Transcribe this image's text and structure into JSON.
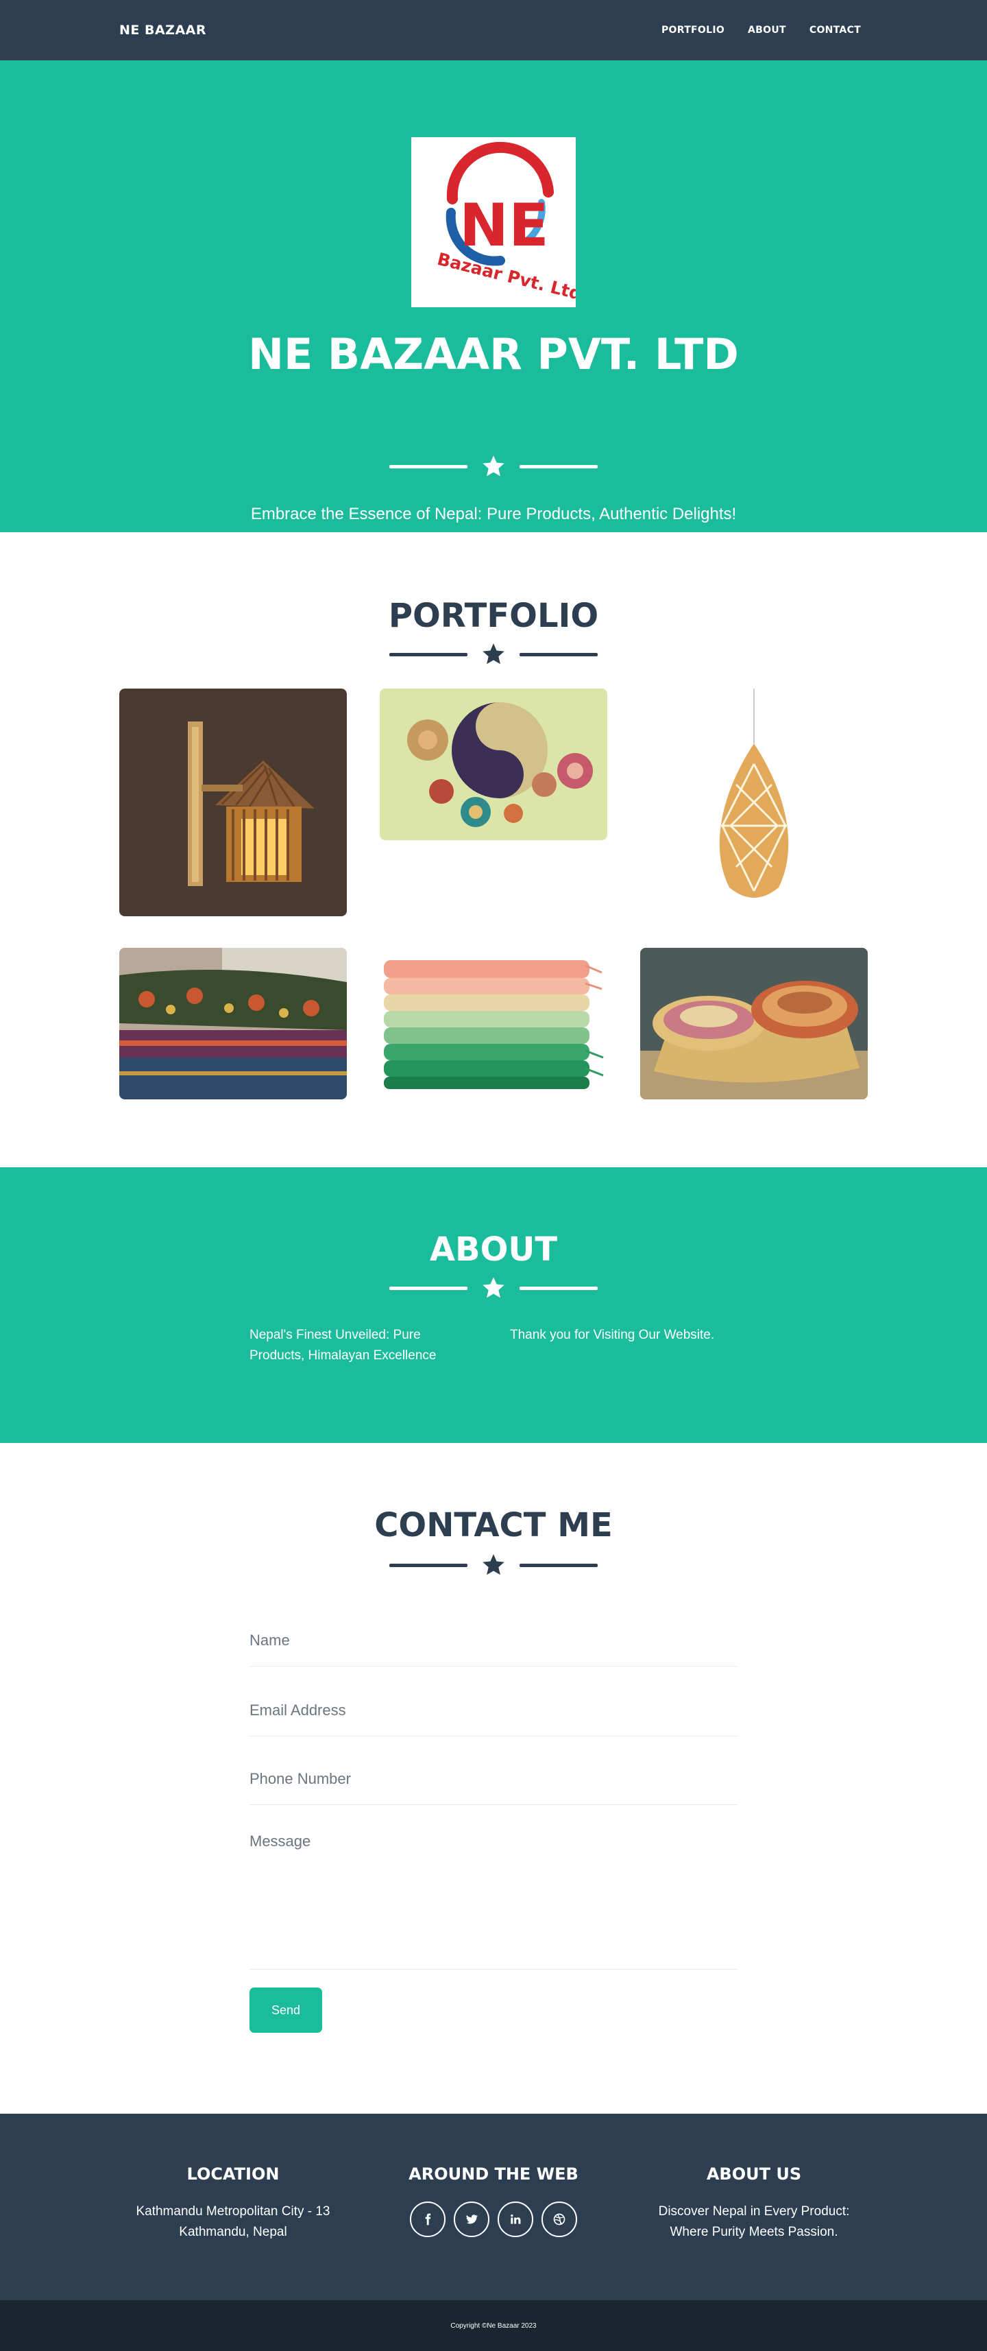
{
  "navbar": {
    "brand": "NE BAZAAR",
    "links": [
      "PORTFOLIO",
      "ABOUT",
      "CONTACT"
    ]
  },
  "hero": {
    "logo_text_top": "NE",
    "logo_text_bottom": "Bazaar Pvt. Ltd.",
    "title": "NE BAZAAR PVT. LTD",
    "tagline": "Embrace the Essence of Nepal: Pure Products, Authentic Delights!"
  },
  "portfolio": {
    "title": "PORTFOLIO",
    "items": [
      "bamboo-wall-lamp",
      "woven-wall-plates",
      "bamboo-pendant-lamp",
      "folded-woven-textiles",
      "stacked-pashmina-shawls",
      "woven-baskets"
    ]
  },
  "about": {
    "title": "ABOUT",
    "left_text": "Nepal's Finest Unveiled: Pure Products, Himalayan Excellence",
    "right_text": "Thank you for Visiting Our Website."
  },
  "contact": {
    "title": "CONTACT ME",
    "name_placeholder": "Name",
    "email_placeholder": "Email Address",
    "phone_placeholder": "Phone Number",
    "message_placeholder": "Message",
    "send_label": "Send"
  },
  "footer": {
    "location_title": "LOCATION",
    "location_line1": "Kathmandu Metropolitan City - 13",
    "location_line2": "Kathmandu, Nepal",
    "web_title": "AROUND THE WEB",
    "socials": [
      "facebook-icon",
      "twitter-icon",
      "linkedin-icon",
      "dribbble-icon"
    ],
    "about_title": "ABOUT US",
    "about_line1": "Discover Nepal in Every Product:",
    "about_line2": "Where Purity Meets Passion.",
    "copyright": "Copyright ©Ne Bazaar 2023"
  },
  "colors": {
    "primary": "#1abc9c",
    "dark": "#2c3e50",
    "darker": "#1a252f"
  }
}
